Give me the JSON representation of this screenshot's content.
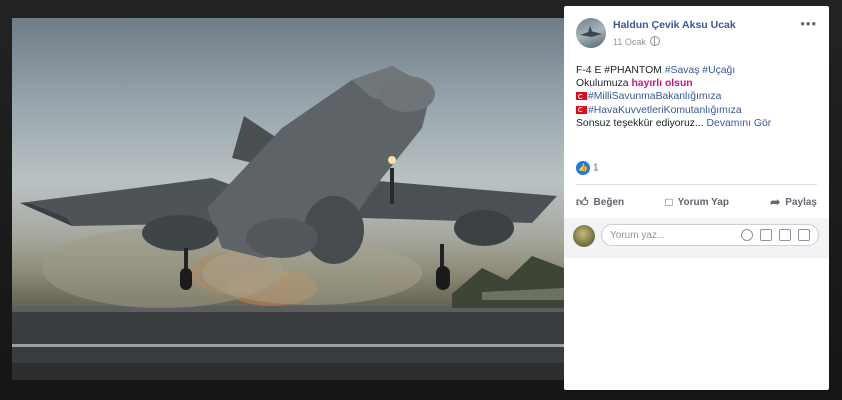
{
  "post": {
    "author": "Haldun Çevik Aksu Ucak",
    "date": "11 Ocak",
    "more": "•••",
    "lines": [
      {
        "parts": [
          {
            "text": "F-4 E #PHANTOM ",
            "style": "plain"
          },
          {
            "text": "#Savaş",
            "style": "hashtag"
          },
          {
            "text": " ",
            "style": "plain"
          },
          {
            "text": "#Uçağı",
            "style": "hashtag"
          }
        ]
      },
      {
        "parts": [
          {
            "text": "Okulumuza ",
            "style": "plain"
          },
          {
            "text": "hayırlı olsun",
            "style": "pink"
          }
        ]
      },
      {
        "flag": true,
        "parts": [
          {
            "text": "#MilliSavunmaBakanlığımıza",
            "style": "hashtag"
          }
        ]
      },
      {
        "flag": true,
        "parts": [
          {
            "text": "#HavaKuvvetleriKomutanlığımıza",
            "style": "hashtag"
          }
        ]
      },
      {
        "parts": [
          {
            "text": "Sonsuz teşekkür ediyoruz... ",
            "style": "plain"
          },
          {
            "text": "Devamını Gör",
            "style": "see-more"
          }
        ]
      }
    ],
    "reaction_count": "1"
  },
  "actions": {
    "like": "Beğen",
    "comment": "Yorum Yap",
    "share": "Paylaş"
  },
  "comment_box": {
    "placeholder": "Yorum yaz..."
  },
  "icons": {
    "like": "thumbs-up-icon",
    "comment": "speech-bubble-icon",
    "share": "share-arrow-icon",
    "close": "close-icon"
  },
  "colors": {
    "link": "#385898",
    "accent": "#1877f2",
    "pink": "#c71585",
    "flag": "#e30a17"
  }
}
